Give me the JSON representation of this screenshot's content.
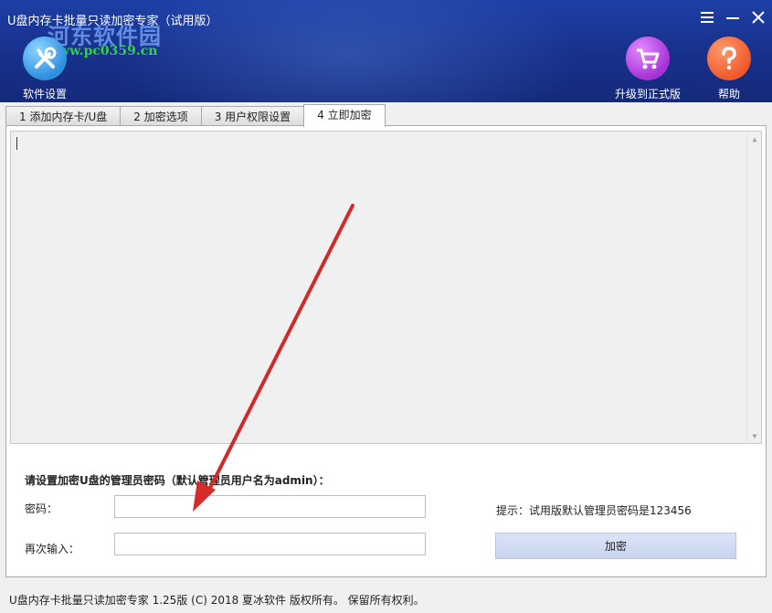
{
  "window": {
    "title": "U盘内存卡批量只读加密专家（试用版）"
  },
  "watermark": {
    "name": "河东软件园",
    "url": "www.pc0359.cn"
  },
  "toolbar": {
    "settings_label": "软件设置",
    "upgrade_label": "升级到正式版",
    "help_label": "帮助"
  },
  "tabs": [
    {
      "label": "1 添加内存卡/U盘",
      "active": false
    },
    {
      "label": "2 加密选项",
      "active": false
    },
    {
      "label": "3 用户权限设置",
      "active": false
    },
    {
      "label": "4 立即加密",
      "active": true
    }
  ],
  "form": {
    "title": "请设置加密U盘的管理员密码（默认管理员用户名为admin）：",
    "password_label": "密码：",
    "password_value": "",
    "confirm_label": "再次输入：",
    "confirm_value": "",
    "hint": "提示：试用版默认管理员密码是123456",
    "encrypt_label": "加密"
  },
  "status": {
    "copyright": "U盘内存卡批量只读加密专家 1.25版 (C) 2018 夏冰软件 版权所有。 保留所有权利。"
  },
  "colors": {
    "header_bg": "#17308a",
    "annotation_arrow": "#d62b2b"
  }
}
